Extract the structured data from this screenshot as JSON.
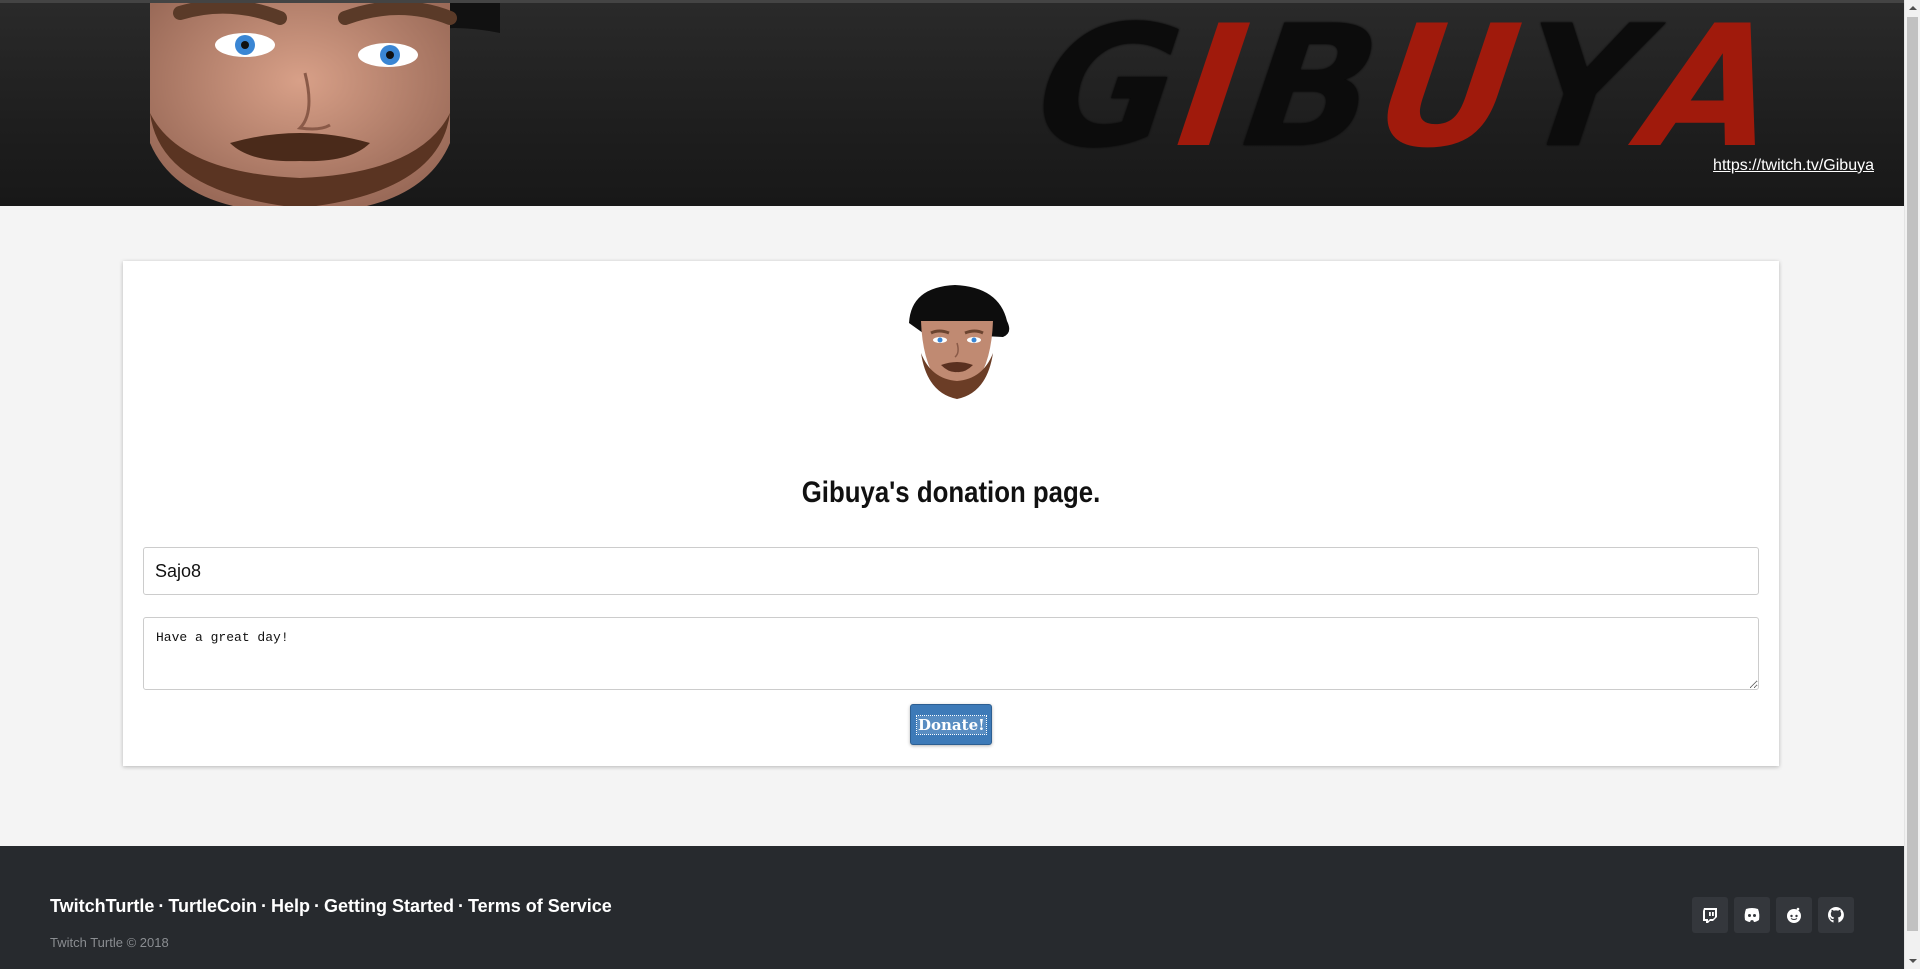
{
  "banner": {
    "logo_black_1": "G",
    "logo_red_1": "I",
    "logo_black_2": "B",
    "logo_red_2": "U",
    "logo_black_3": "Y",
    "logo_red_3": "A",
    "twitch_link": "https://twitch.tv/Gibuya"
  },
  "card": {
    "title": "Gibuya's donation page.",
    "name_value": "Sajo8",
    "message_value": "Have a great day!",
    "donate_label": "Donate!"
  },
  "footer": {
    "links": [
      "TwitchTurtle",
      "TurtleCoin",
      "Help",
      "Getting Started",
      "Terms of Service"
    ],
    "separator": "·",
    "copyright": "Twitch Turtle © 2018",
    "icons": [
      "twitch-icon",
      "discord-icon",
      "reddit-icon",
      "github-icon"
    ]
  },
  "colors": {
    "accent": "#3d7ab8",
    "logo_red": "#a01a0c",
    "footer_bg": "#272a2e"
  }
}
